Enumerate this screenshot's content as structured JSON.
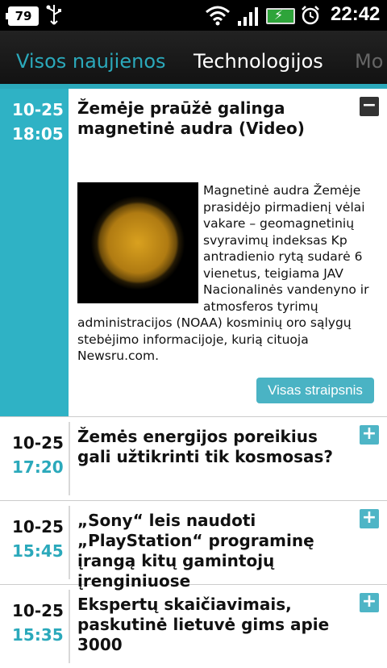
{
  "status_bar": {
    "battery_level": "79",
    "charging_indicator": "⚡",
    "clock": "22:42",
    "icons": [
      "battery-icon",
      "usb-icon",
      "wifi-icon",
      "signal-icon",
      "charging-battery-icon",
      "alarm-icon"
    ]
  },
  "tabs": [
    {
      "label": "Visos naujienos",
      "active": true
    },
    {
      "label": "Technologijos",
      "active": false
    },
    {
      "label": "Mo",
      "active": false
    }
  ],
  "colors": {
    "accent": "#2fb2c5",
    "button": "#4ab3c4",
    "minus_toggle": "#333333"
  },
  "articles": [
    {
      "date": "10-25",
      "time": "18:05",
      "title": "Žemėje praūžė galinga magnetinė audra (Video)",
      "toggle": "−",
      "expanded": true,
      "image": "sun-photo",
      "body": "Magnetinė audra Žemėje prasidėjo pirmadienį vėlai vakare – geomagnetinių svyravimų indeksas Kp antradienio rytą sudarė 6 vienetus, teigiama JAV Nacionalinės vandenyno ir atmosferos tyrimų administracijos (NOAA) kosminių oro sąlygų stebėjimo informacijoje, kurią cituoja Newsru.com.",
      "read_more": "Visas straipsnis"
    },
    {
      "date": "10-25",
      "time": "17:20",
      "title": "Žemės energijos poreikius gali užtikrinti tik kosmosas?",
      "toggle": "+",
      "expanded": false
    },
    {
      "date": "10-25",
      "time": "15:45",
      "title": "„Sony“ leis naudoti „PlayStation“ programinę įrangą kitų gamintojų įrenginiuose",
      "toggle": "+",
      "expanded": false
    },
    {
      "date": "10-25",
      "time": "15:35",
      "title": "Ekspertų skaičiavimais, paskutinė lietuvė gims apie 3000",
      "toggle": "+",
      "expanded": false
    }
  ]
}
